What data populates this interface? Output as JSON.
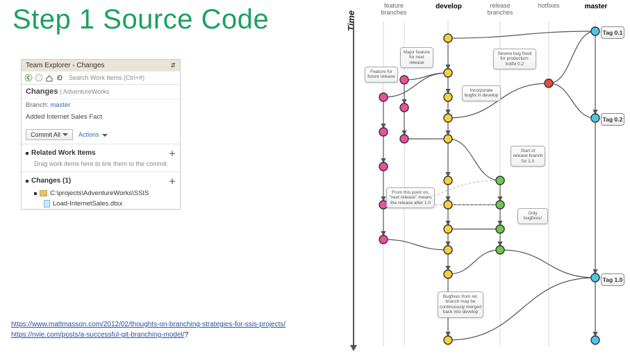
{
  "title": "Step 1 Source Code",
  "team_explorer": {
    "window_title": "Team Explorer - Changes",
    "search_placeholder": "Search Work Items (Ctrl+#)",
    "changes_header": "Changes",
    "project_name": "AdventureWorks",
    "branch_label": "Branch:",
    "branch_value": "master",
    "commit_message": "Added Internet Sales Fact",
    "commit_button": "Commit All",
    "actions_link": "Actions",
    "related_header": "Related Work Items",
    "related_hint": "Drag work items here to link them to the commit.",
    "changes_count_header": "Changes (1)",
    "tree_folder": "C:\\projects\\AdventureWorks\\SSIS",
    "tree_file": "Load-InternetSales.dtsx"
  },
  "links": {
    "l1_text": "https://www.mattmasson.com/2012/02/thoughts-on-branching-strategies-for-ssis-projects/",
    "l2_text": "https://nvie.com/posts/a-successful-git-branching-model/",
    "l2_suffix": "?"
  },
  "gitflow": {
    "time_label": "Time",
    "lanes": {
      "feature": "feature\nbranches",
      "develop": "develop",
      "release": "release\nbranches",
      "hotfixes": "hotfixes",
      "master": "master"
    },
    "tags": {
      "t01": "Tag\n0.1",
      "t02": "Tag\n0.2",
      "t10": "Tag\n1.0"
    },
    "notes": {
      "n_feature_future": "Feature\nfor future\nrelease",
      "n_major_next": "Major\nfeature for\nnext release",
      "n_severe_bug": "Severe bug\nfixed for\nproduction:\nhotfix 0.2",
      "n_incorporate": "Incorporate\nbugfix in\ndevelop",
      "n_start_release": "Start of\nrelease\nbranch for\n1.0",
      "n_from_point": "From this point on,\n\"next release\"\nmeans the release\nafter 1.0",
      "n_only_bugfixes": "Only\nbugfixes!",
      "n_rel_merge": "Bugfixes from\nrel. branch\nmay be\ncontinuously\nmerged back\ninto develop"
    },
    "lane_x": {
      "feature1": 82,
      "feature2": 112,
      "develop": 175,
      "release": 250,
      "hotfix": 320,
      "master": 387
    },
    "colors": {
      "feature": "#ec4fa0",
      "develop": "#f4d13a",
      "release": "#6fc84d",
      "hotfix": "#ef4b3e",
      "master": "#4fc6e8"
    },
    "commits": {
      "develop": [
        55,
        105,
        140,
        170,
        200,
        260,
        295,
        330,
        360,
        395,
        440,
        490
      ],
      "feature1": [
        140,
        190,
        240,
        295,
        345
      ],
      "feature2": [
        115,
        155,
        200
      ],
      "release": [
        260,
        295,
        330,
        360
      ],
      "hotfix": [
        120
      ],
      "master": [
        45,
        170,
        400,
        490
      ]
    }
  }
}
